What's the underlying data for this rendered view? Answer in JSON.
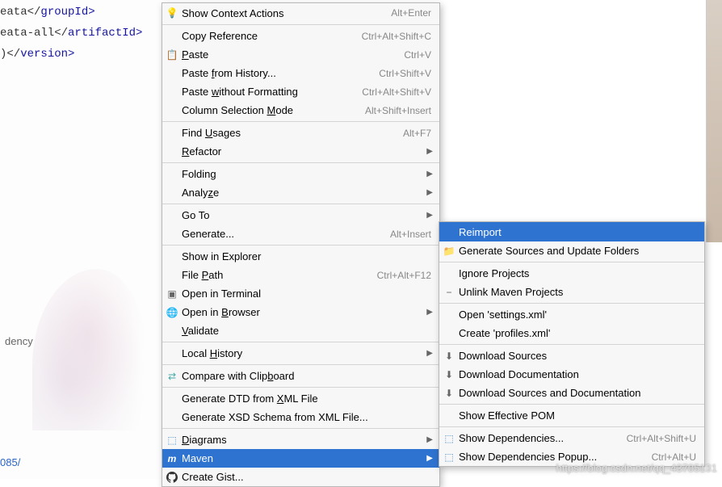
{
  "code": {
    "line1_before": "eata</",
    "line1_tag": "groupId",
    "line1_after": ">",
    "line2_before": "eata-all</",
    "line2_tag": "artifactId",
    "line2_after": ">",
    "line3_before": ")</",
    "line3_tag": "version",
    "line3_after": ">"
  },
  "panel_label": "dency",
  "num_label": "085/",
  "watermark": "https://blog.csdn.net/qq_43705131",
  "menu": {
    "show_context_actions": "Show Context Actions",
    "show_context_actions_sc": "Alt+Enter",
    "copy_reference": "Copy Reference",
    "copy_reference_sc": "Ctrl+Alt+Shift+C",
    "paste": "Paste",
    "paste_sc": "Ctrl+V",
    "paste_history": "Paste from History...",
    "paste_history_sc": "Ctrl+Shift+V",
    "paste_wo_fmt": "Paste without Formatting",
    "paste_wo_fmt_sc": "Ctrl+Alt+Shift+V",
    "col_sel": "Column Selection Mode",
    "col_sel_sc": "Alt+Shift+Insert",
    "find_usages": "Find Usages",
    "find_usages_sc": "Alt+F7",
    "refactor": "Refactor",
    "folding": "Folding",
    "analyze": "Analyze",
    "goto": "Go To",
    "generate": "Generate...",
    "generate_sc": "Alt+Insert",
    "show_explorer": "Show in Explorer",
    "file_path": "File Path",
    "file_path_sc": "Ctrl+Alt+F12",
    "open_terminal": "Open in Terminal",
    "open_browser": "Open in Browser",
    "validate": "Validate",
    "local_history": "Local History",
    "compare_clip": "Compare with Clipboard",
    "gen_dtd": "Generate DTD from XML File",
    "gen_xsd": "Generate XSD Schema from XML File...",
    "diagrams": "Diagrams",
    "maven": "Maven",
    "create_gist": "Create Gist..."
  },
  "submenu": {
    "reimport": "Reimport",
    "gen_sources": "Generate Sources and Update Folders",
    "ignore_projects": "Ignore Projects",
    "unlink_maven": "Unlink Maven Projects",
    "open_settings": "Open 'settings.xml'",
    "create_profiles": "Create 'profiles.xml'",
    "dl_sources": "Download Sources",
    "dl_docs": "Download Documentation",
    "dl_src_docs": "Download Sources and Documentation",
    "show_eff_pom": "Show Effective POM",
    "show_deps": "Show Dependencies...",
    "show_deps_sc": "Ctrl+Alt+Shift+U",
    "show_deps_popup": "Show Dependencies Popup...",
    "show_deps_popup_sc": "Ctrl+Alt+U"
  }
}
